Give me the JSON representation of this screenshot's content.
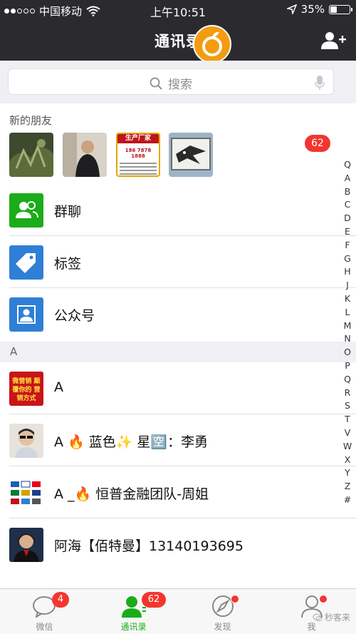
{
  "status_bar": {
    "carrier": "中国移动",
    "time": "上午10:51",
    "battery": "35%",
    "battery_level": 0.35
  },
  "nav": {
    "title": "通讯录"
  },
  "search": {
    "placeholder": "搜索"
  },
  "new_friends": {
    "label": "新的朋友",
    "badge": "62",
    "thumb3_title": "生产厂家",
    "thumb3_phone": "186 7878 1888"
  },
  "features": [
    {
      "label": "群聊",
      "color": "#1aad19"
    },
    {
      "label": "标签",
      "color": "#2f7fd6"
    },
    {
      "label": "公众号",
      "color": "#2f7fd6"
    }
  ],
  "section_header": "A",
  "contacts": [
    {
      "name": "A",
      "avatar_text": "微营销 颠覆你的 营销方式"
    },
    {
      "name": "A 🔥 蓝色✨ 星🈳：李勇"
    },
    {
      "name": "A _🔥 恒普金融团队-周姐"
    },
    {
      "name": "阿海【佰特曼】13140193695"
    }
  ],
  "index_letters": [
    "Q",
    "A",
    "B",
    "C",
    "D",
    "E",
    "F",
    "G",
    "H",
    "J",
    "K",
    "L",
    "M",
    "N",
    "O",
    "P",
    "Q",
    "R",
    "S",
    "T",
    "V",
    "W",
    "X",
    "Y",
    "Z",
    "#"
  ],
  "tabs": [
    {
      "label": "微信",
      "badge": "4"
    },
    {
      "label": "通讯录",
      "badge": "62"
    },
    {
      "label": "发现"
    },
    {
      "label": "我"
    }
  ],
  "watermark": "秒客来",
  "colors": {
    "header": "#2b2b2f",
    "accent": "#1aad19",
    "badge": "#f43530"
  }
}
